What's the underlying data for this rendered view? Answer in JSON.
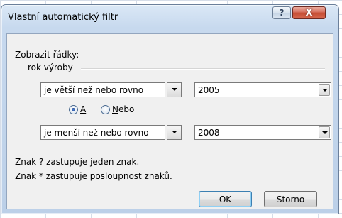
{
  "window": {
    "title": "Vlastní automatický filtr",
    "help_glyph": "?",
    "close_glyph": "X"
  },
  "group": {
    "show_rows_label": "Zobrazit řádky:",
    "field_name": "rok výroby"
  },
  "condition1": {
    "operator": "je větší než nebo rovno",
    "value": "2005"
  },
  "logic": {
    "and_label": "A",
    "or_label_prefix": "N",
    "or_label_rest": "ebo",
    "selected": "A"
  },
  "condition2": {
    "operator": "je menší než nebo rovno",
    "value": "2008"
  },
  "hints": {
    "line1": "Znak ? zastupuje jeden znak.",
    "line2": "Znak * zastupuje posloupnost znaků."
  },
  "buttons": {
    "ok": "OK",
    "cancel": "Storno"
  }
}
